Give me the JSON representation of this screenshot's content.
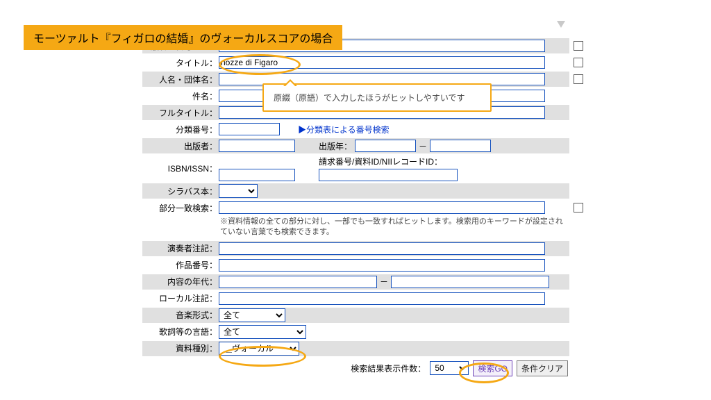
{
  "banner": "モーツァルト『フィガロの結婚』のヴォーカルスコアの場合",
  "bubble": "原綴（原語）で入力したほうがヒットしやすいです",
  "labels": {
    "edition": "版者・番号など：",
    "title": "タイトル：",
    "name": "人名・団体名：",
    "subject": "件名：",
    "fulltitle": "フルタイトル：",
    "classno": "分類番号：",
    "publisher": "出版者：",
    "pubyear": "出版年：",
    "isbn": "ISBN/ISSN：",
    "reqno": "請求番号/資料ID/NIIレコードID：",
    "syllabus": "シラバス本：",
    "partial": "部分一致検索：",
    "performer": "演奏者注記：",
    "workno": "作品番号：",
    "contentyear": "内容の年代：",
    "localnote": "ローカル注記：",
    "musicform": "音楽形式：",
    "lyriclang": "歌詞等の言語：",
    "mattype": "資料種別：",
    "resultcount": "検索結果表示件数："
  },
  "values": {
    "title": "nozze di Figaro",
    "musicform": "全て",
    "lyriclang": "全て",
    "mattype": "＿ヴォーカル",
    "resultcount": "50"
  },
  "links": {
    "classlookup": "▶分類表による番号検索"
  },
  "notes": {
    "partial": "※資料情報の全ての部分に対し、一部でも一致すればヒットします。検索用のキーワードが設定されていない言葉でも検索できます。"
  },
  "buttons": {
    "go": "検索GO",
    "clear": "条件クリア"
  },
  "dash": "－"
}
